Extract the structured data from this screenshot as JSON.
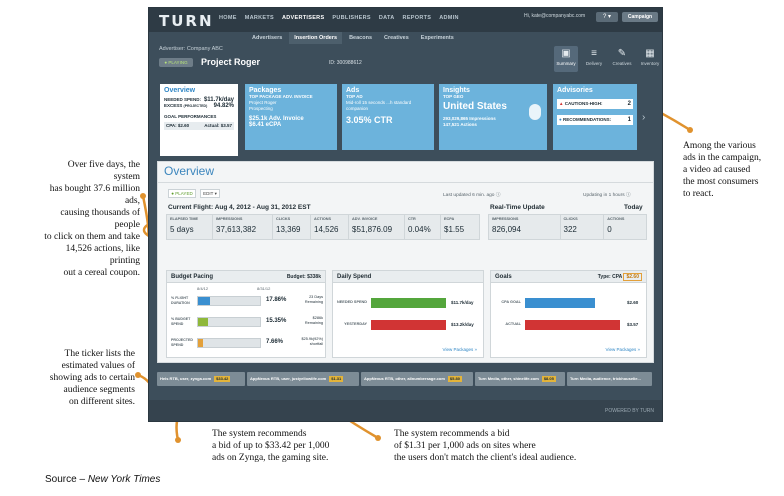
{
  "app": {
    "logo": "TURN",
    "nav": [
      "HOME",
      "MARKETS",
      "ADVERTISERS",
      "PUBLISHERS",
      "DATA",
      "REPORTS",
      "ADMIN"
    ],
    "nav_active": "ADVERTISERS",
    "user": "Hi, kate@companyabc.com",
    "help": "? ▾",
    "campaign_button": "Campaign",
    "subnav": [
      "Advertisers",
      "Insertion Orders",
      "Beacons",
      "Creatives",
      "Experiments"
    ],
    "subnav_active": "Insertion Orders",
    "advertiser": "Advertiser: Company ABC",
    "status": "● PLAYING",
    "project": "Project Roger",
    "project_id": "ID: 300988612",
    "icons": [
      {
        "label": "Summary",
        "icon": "briefcase-icon",
        "glyph": "▣"
      },
      {
        "label": "Delivery",
        "icon": "stack-icon",
        "glyph": "≡"
      },
      {
        "label": "Creatives",
        "icon": "pencil-icon",
        "glyph": "✎"
      },
      {
        "label": "Inventory",
        "icon": "grid-icon",
        "glyph": "▦"
      }
    ]
  },
  "cards": {
    "overview": {
      "title": "Overview",
      "needed_label": "NEEDED SPEND:",
      "needed_value": "$11.7k/day",
      "excess_label": "EXCESS",
      "excess_small": "(PROJECTED)",
      "excess_value": "94.82%",
      "goal_label": "GOAL PERFORMANCES",
      "cpa_label": "CPA: $2.60",
      "actual_label": "Actual: $3.57"
    },
    "packages": {
      "title": "Packages",
      "line1": "TOP PACKAGE ADV. INVOICE",
      "line2": "Project Roger",
      "line3": "Prospecting",
      "line4": "$25.1k Adv. Invoice",
      "line5": "$6.41 eCPA"
    },
    "ads": {
      "title": "Ads",
      "line1": "TOP AD",
      "line2": "Mid-roll 15 seconds ...h standard",
      "line3": "companion",
      "big": "3.05% CTR"
    },
    "insights": {
      "title": "Insights",
      "line1": "TOP GEO",
      "big": "United States",
      "line3": "293,029,865 Impressions",
      "line4": "147,521 Actions"
    },
    "advisories": {
      "title": "Advisories",
      "line1": "CAUTIONS-HIGH:",
      "v1": "2",
      "line2": "RECOMMENDATIONS:",
      "v2": "1"
    }
  },
  "panel": {
    "title": "Overview",
    "play_button": "● PLAYED",
    "edit_button": "EDIT ▾",
    "last_updated": "Last updated 6 min. ago ⓘ",
    "updating_in": "Updating in 1 hours ⓘ",
    "flight": "Current Flight: Aug 4, 2012 - Aug 31, 2012 EST",
    "flight_stats": [
      {
        "label": "ELAPSED TIME",
        "value": "5 days"
      },
      {
        "label": "IMPRESSIONS",
        "value": "37,613,382"
      },
      {
        "label": "CLICKS",
        "value": "13,369"
      },
      {
        "label": "ACTIONS",
        "value": "14,526"
      },
      {
        "label": "ADV. INVOICE",
        "value": "$51,876.09"
      },
      {
        "label": "CTR",
        "value": "0.04%"
      },
      {
        "label": "ECPA",
        "value": "$1.55"
      }
    ],
    "rt_title": "Real-Time Update",
    "rt_today": "Today",
    "rt_stats": [
      {
        "label": "IMPRESSIONS",
        "value": "826,094"
      },
      {
        "label": "CLICKS",
        "value": "322"
      },
      {
        "label": "ACTIONS",
        "value": "0"
      }
    ],
    "budget": {
      "title": "Budget Pacing",
      "right": "Budget: $338k",
      "date_start": "8/4/12",
      "date_end": "8/31/12",
      "rows": [
        {
          "label": "% FLIGHT DURATION",
          "pct": "17.86%",
          "note": "23 Days Remaining",
          "fill": 0.18,
          "color": "#3a8fd0"
        },
        {
          "label": "% BUDGET SPEND",
          "pct": "15.35%",
          "note": "$286k Remaining",
          "fill": 0.15,
          "color": "#8fb83a"
        },
        {
          "label": "PROJECTED SPEND",
          "pct": "7.66%",
          "note": "$25.9k(92%) shortfall",
          "fill": 0.08,
          "color": "#e3a03a"
        }
      ]
    },
    "daily": {
      "title": "Daily Spend",
      "rows": [
        {
          "label": "NEEDED SPEND",
          "value": "$11.7k/day",
          "color": "#54a63c",
          "fill": 0.99
        },
        {
          "label": "YESTERDAY",
          "value": "$13.2k/day",
          "color": "#d13434",
          "fill": 0.99
        }
      ],
      "link": "View Packages »"
    },
    "goals": {
      "title": "Goals",
      "type_label": "Type: CPA",
      "type_value": "$2.60",
      "rows": [
        {
          "label": "CPA GOAL",
          "value": "$2.60",
          "fill": 0.73,
          "color": "#3a8fd0"
        },
        {
          "label": "ACTUAL",
          "value": "$3.57",
          "fill": 0.99,
          "color": "#d13434"
        }
      ],
      "link": "View Packages »"
    }
  },
  "ticker": [
    {
      "text": "Hels RTB, user, zynga.com",
      "price": "$33.42"
    },
    {
      "text": "AppNexus RTB, user, justyellowlife.com",
      "price": "$1.31"
    },
    {
      "text": "AppNexus RTB, other, allnumbersage.com",
      "price": "$5.80"
    },
    {
      "text": "Turn Media, other, shinelife.com",
      "price": "$8.05"
    },
    {
      "text": "Turn Media, audience, trickhouselie...",
      "price": ""
    }
  ],
  "powered": "POWERED BY TURN",
  "annotations": {
    "left_top": [
      "Over five days, the system",
      "has bought  37.6 million ads,",
      "causing thousands of people",
      "to click on them and take",
      "14,526 actions, like printing",
      "out a cereal coupon."
    ],
    "left_bottom": [
      "The ticker lists the",
      "estimated values of",
      "showing ads to certain",
      "audience segments",
      "on different sites."
    ],
    "right": [
      "Among the various",
      "ads in the campaign,",
      "a video ad caused",
      "the most consumers",
      "to react."
    ],
    "bottom_left": [
      "The system recommends",
      "a bid of up to $33.42 per 1,000",
      "ads on Zynga, the gaming site."
    ],
    "bottom_right": [
      "The system recommends a bid",
      "of $1.31 per 1,000 ads on sites where",
      "the users don't match the client's ideal audience."
    ]
  },
  "source": {
    "prefix": "Source – ",
    "name": "New York Times"
  },
  "colors": {
    "accent_orange": "#e0922e",
    "card_blue": "#6cb3dc",
    "chrome": "#3d4e5b"
  }
}
